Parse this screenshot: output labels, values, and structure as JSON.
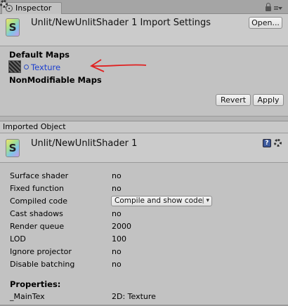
{
  "tab": {
    "label": "Inspector"
  },
  "header": {
    "title": "Unlit/NewUnlitShader 1 Import Settings",
    "shader_letter": "S",
    "open_label": "Open..."
  },
  "maps": {
    "default_label": "Default Maps",
    "texture_label": "Texture",
    "nonmodifiable_label": "NonModifiable Maps"
  },
  "buttons": {
    "revert": "Revert",
    "apply": "Apply"
  },
  "imported": {
    "bar_label": "Imported Object",
    "title": "Unlit/NewUnlitShader 1",
    "shader_letter": "S",
    "help_glyph": "?"
  },
  "properties": {
    "rows": [
      {
        "key": "Surface shader",
        "value": "no"
      },
      {
        "key": "Fixed function",
        "value": "no"
      },
      {
        "key": "Compiled code",
        "value": "Compile and show code"
      },
      {
        "key": "Cast shadows",
        "value": "no"
      },
      {
        "key": "Render queue",
        "value": "2000"
      },
      {
        "key": "LOD",
        "value": "100"
      },
      {
        "key": "Ignore projector",
        "value": "no"
      },
      {
        "key": "Disable batching",
        "value": "no"
      }
    ],
    "section_label": "Properties:",
    "maintex_key": "_MainTex",
    "maintex_value": "2D: Texture"
  },
  "colors": {
    "link": "#1c3fcf",
    "annotation_arrow": "#e02020",
    "panel": "#c2c2c2"
  }
}
